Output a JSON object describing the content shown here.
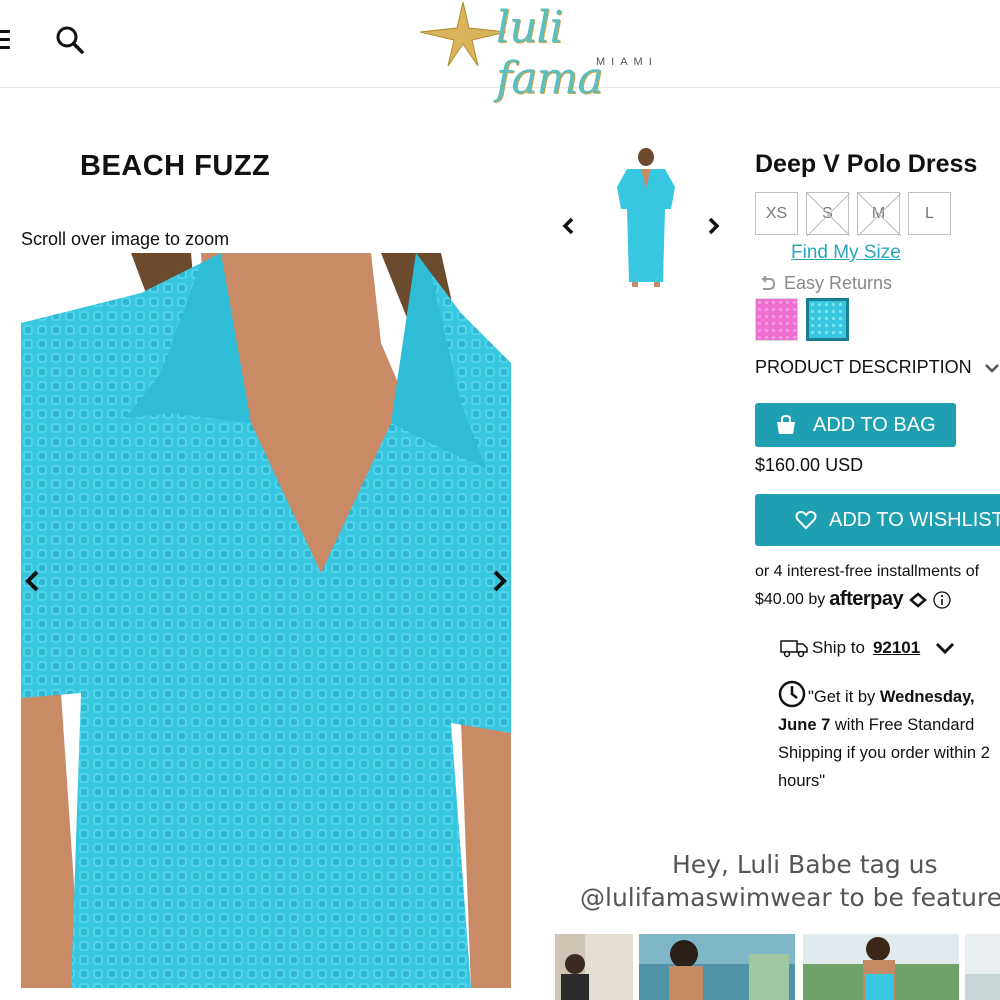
{
  "header": {
    "logo_text": "luli fama",
    "logo_subtext": "MIAMI",
    "menu_icon": "hamburger-menu-icon",
    "search_icon": "search-icon"
  },
  "gallery": {
    "brand_title": "BEACH FUZZ",
    "zoom_hint": "Scroll over image to zoom",
    "prev_icon": "chevron-left-icon",
    "next_icon": "chevron-right-icon"
  },
  "product": {
    "title": "Deep V Polo Dress",
    "sizes": [
      {
        "label": "XS",
        "available": true
      },
      {
        "label": "S",
        "available": false
      },
      {
        "label": "M",
        "available": false
      },
      {
        "label": "L",
        "available": true
      }
    ],
    "find_size": "Find My Size",
    "easy_returns": "Easy Returns",
    "swatches": [
      {
        "name": "pink",
        "color": "#ef6fd0",
        "selected": false
      },
      {
        "name": "aqua",
        "color": "#38c7e0",
        "selected": true
      }
    ],
    "description_toggle": "PRODUCT DESCRIPTION",
    "add_to_bag": "ADD TO BAG",
    "price": "$160.00 USD",
    "add_to_wishlist": "ADD TO WISHLIST",
    "afterpay_line1": "or 4 interest-free installments of",
    "afterpay_amount": "$40.00 by",
    "afterpay_brand": "afterpay",
    "ship_to_label": "Ship to",
    "ship_zip": "92101",
    "delivery_intro": "\"Get it by ",
    "delivery_day": "Wednesday,",
    "delivery_date": "June 7",
    "delivery_rest": " with Free Standard Shipping if you order within 2 hours\""
  },
  "social": {
    "line1": "Hey, Luli Babe tag us",
    "line2": "@lulifamaswimwear to be featured"
  },
  "colors": {
    "accent": "#1f9fb2",
    "link": "#2aa7b8",
    "dress": "#38c7e0"
  }
}
